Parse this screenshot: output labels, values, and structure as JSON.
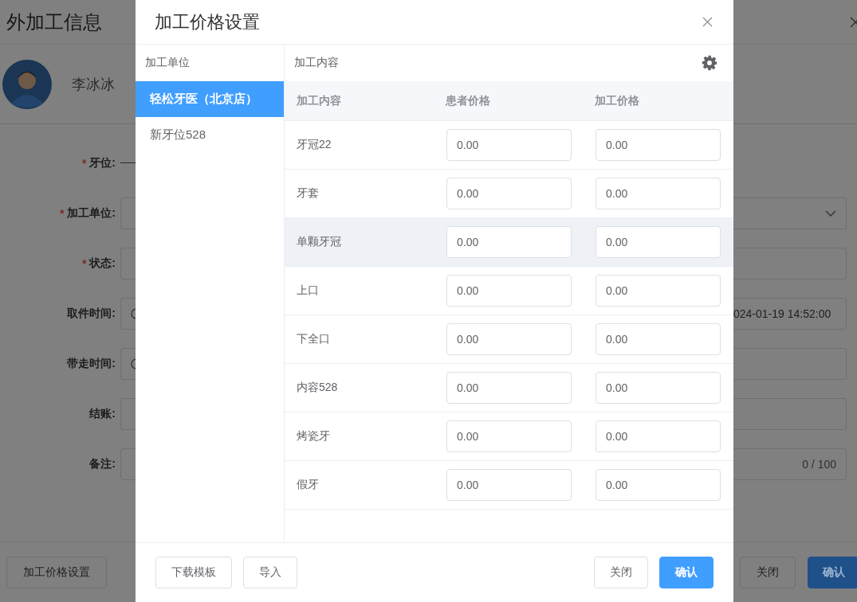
{
  "background": {
    "title": "外加工信息",
    "patient_name": "李冰冰",
    "form": [
      {
        "required_mark": "*",
        "label": "牙位:",
        "kind": "line"
      },
      {
        "required_mark": "*",
        "label": "加工单位:",
        "kind": "select"
      },
      {
        "required_mark": "*",
        "label": "状态:",
        "kind": "input"
      },
      {
        "label": "取件时间:",
        "kind": "time",
        "value": "024-01-19 14:52:00"
      },
      {
        "label": "带走时间:",
        "kind": "time"
      },
      {
        "label": "结账:",
        "kind": "input"
      },
      {
        "label": "备注:",
        "kind": "textarea",
        "counter": "0 / 100"
      }
    ],
    "left_button": "加工价格设置",
    "right_buttons": [
      {
        "label": "关闭",
        "primary": false
      },
      {
        "label": "确认",
        "primary": true
      }
    ]
  },
  "dialog": {
    "title": "加工价格设置",
    "units_header": "加工单位",
    "units": [
      {
        "name": "轻松牙医（北京店）",
        "selected": true
      },
      {
        "name": "新牙位528",
        "selected": false
      }
    ],
    "content_header": "加工内容",
    "columns": [
      "加工内容",
      "患者价格",
      "加工价格"
    ],
    "rows": [
      {
        "name": "牙冠22",
        "patient_price": "0.00",
        "price": "0.00",
        "hover": false
      },
      {
        "name": "牙套",
        "patient_price": "0.00",
        "price": "0.00",
        "hover": false
      },
      {
        "name": "单颗牙冠",
        "patient_price": "0.00",
        "price": "0.00",
        "hover": true
      },
      {
        "name": "上口",
        "patient_price": "0.00",
        "price": "0.00",
        "hover": false
      },
      {
        "name": "下全口",
        "patient_price": "0.00",
        "price": "0.00",
        "hover": false
      },
      {
        "name": "内容528",
        "patient_price": "0.00",
        "price": "0.00",
        "hover": false
      },
      {
        "name": "烤瓷牙",
        "patient_price": "0.00",
        "price": "0.00",
        "hover": false
      },
      {
        "name": "假牙",
        "patient_price": "0.00",
        "price": "0.00",
        "hover": false
      }
    ],
    "footer_left": [
      "下载模板",
      "导入"
    ],
    "footer_right": [
      {
        "label": "关闭",
        "primary": false
      },
      {
        "label": "确认",
        "primary": true
      }
    ]
  }
}
